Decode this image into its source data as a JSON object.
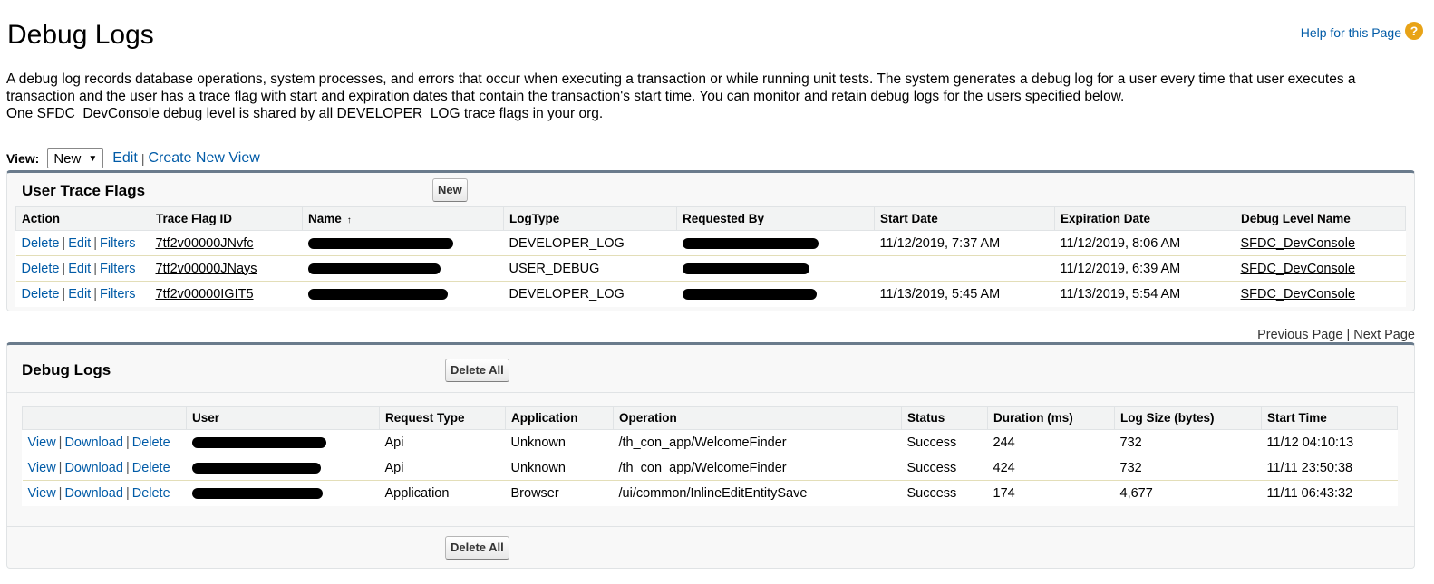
{
  "page": {
    "title": "Debug Logs",
    "help_link": "Help for this Page",
    "help_icon": "help-question-icon",
    "description_line1": "A debug log records database operations, system processes, and errors that occur when executing a transaction or while running unit tests. The system generates a debug log for a user every time that user executes a transaction and the user has a trace flag with start and expiration dates that contain the transaction's start time. You can monitor and retain debug logs for the users specified below.",
    "description_line2": "One SFDC_DevConsole debug level is shared by all DEVELOPER_LOG trace flags in your org."
  },
  "view_bar": {
    "label": "View:",
    "selected": "New",
    "edit_link": "Edit",
    "separator": "|",
    "create_link": "Create New View"
  },
  "trace_flags": {
    "title": "User Trace Flags",
    "new_button": "New",
    "columns": [
      "Action",
      "Trace Flag ID",
      "Name",
      "LogType",
      "Requested By",
      "Start Date",
      "Expiration Date",
      "Debug Level Name"
    ],
    "action_labels": {
      "delete": "Delete",
      "edit": "Edit",
      "filters": "Filters",
      "sep": "|"
    },
    "rows": [
      {
        "id": "7tf2v00000JNvfc",
        "log_type": "DEVELOPER_LOG",
        "start_date": "11/12/2019, 7:37 AM",
        "expiration_date": "11/12/2019, 8:06 AM",
        "debug_level": "SFDC_DevConsole"
      },
      {
        "id": "7tf2v00000JNays",
        "log_type": "USER_DEBUG",
        "start_date": "",
        "expiration_date": "11/12/2019, 6:39 AM",
        "debug_level": "SFDC_DevConsole"
      },
      {
        "id": "7tf2v00000IGIT5",
        "log_type": "DEVELOPER_LOG",
        "start_date": "11/13/2019, 5:45 AM",
        "expiration_date": "11/13/2019, 5:54 AM",
        "debug_level": "SFDC_DevConsole"
      }
    ]
  },
  "pager": {
    "previous": "Previous Page",
    "sep": "|",
    "next": "Next Page"
  },
  "debug_logs": {
    "title": "Debug Logs",
    "delete_all": "Delete All",
    "columns": [
      "",
      "User",
      "Request Type",
      "Application",
      "Operation",
      "Status",
      "Duration (ms)",
      "Log Size (bytes)",
      "Start Time"
    ],
    "action_labels": {
      "view": "View",
      "download": "Download",
      "delete": "Delete",
      "sep": "|"
    },
    "rows": [
      {
        "request_type": "Api",
        "application": "Unknown",
        "operation": "/th_con_app/WelcomeFinder",
        "status": "Success",
        "duration": "244",
        "log_size": "732",
        "start_time": "11/12 04:10:13"
      },
      {
        "request_type": "Api",
        "application": "Unknown",
        "operation": "/th_con_app/WelcomeFinder",
        "status": "Success",
        "duration": "424",
        "log_size": "732",
        "start_time": "11/11 23:50:38"
      },
      {
        "request_type": "Application",
        "application": "Browser",
        "operation": "/ui/common/InlineEditEntitySave",
        "status": "Success",
        "duration": "174",
        "log_size": "4,677",
        "start_time": "11/11 06:43:32"
      }
    ]
  }
}
